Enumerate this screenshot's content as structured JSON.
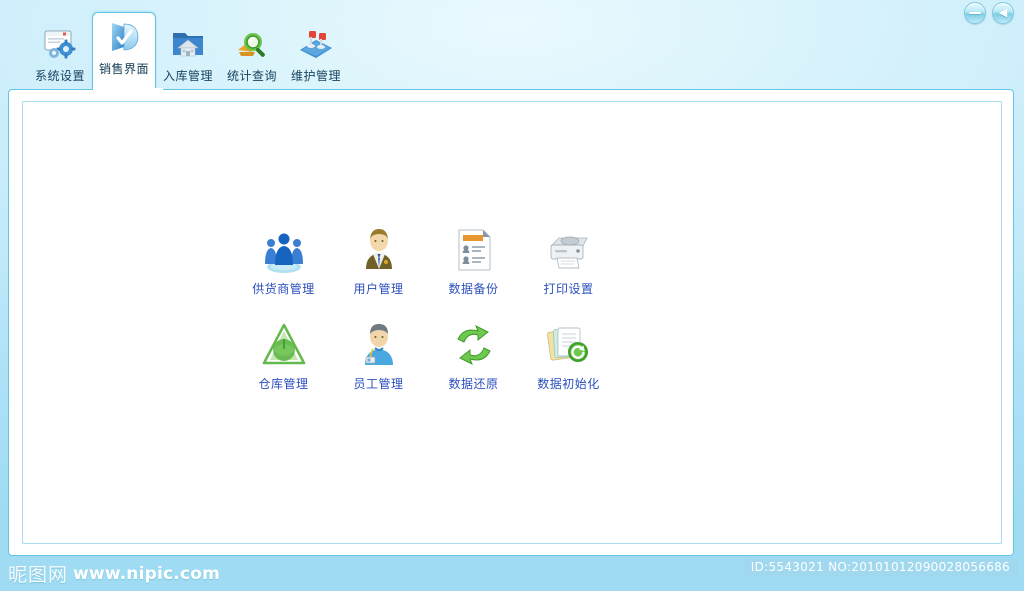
{
  "window": {
    "controls": [
      {
        "name": "minimize-button",
        "icon": "minimize-icon",
        "label": "—"
      },
      {
        "name": "back-button",
        "icon": "back-arrow-icon",
        "label": "◀"
      }
    ]
  },
  "tabs": [
    {
      "label": "系统设置",
      "icon": "settings-window-gear-icon",
      "active": false
    },
    {
      "label": "销售界面",
      "icon": "sales-folder-arrow-icon",
      "active": true
    },
    {
      "label": "入库管理",
      "icon": "warehouse-house-folder-icon",
      "active": false
    },
    {
      "label": "统计查询",
      "icon": "magnifier-chart-icon",
      "active": false
    },
    {
      "label": "维护管理",
      "icon": "pushpin-board-icon",
      "active": false
    }
  ],
  "main": {
    "items": [
      {
        "label": "供货商管理",
        "icon": "people-group-icon"
      },
      {
        "label": "用户管理",
        "icon": "businessman-user-icon"
      },
      {
        "label": "数据备份",
        "icon": "document-contacts-icon"
      },
      {
        "label": "打印设置",
        "icon": "printer-icon"
      },
      {
        "label": "仓库管理",
        "icon": "green-triangle-recycle-icon"
      },
      {
        "label": "员工管理",
        "icon": "employee-badge-icon"
      },
      {
        "label": "数据还原",
        "icon": "green-refresh-arrows-icon"
      },
      {
        "label": "数据初始化",
        "icon": "documents-refresh-icon"
      }
    ]
  },
  "footer": {
    "watermark_cn": "昵图网",
    "watermark_url": "www.nipic.com",
    "id_text": "ID:5543021 NO:20101012090028056686"
  },
  "colors": {
    "accent": "#5fc4e4",
    "label_blue": "#2b4fbe",
    "tab_text": "#18425f",
    "bg_top": "#eaf9fe",
    "bg_bottom": "#9fdcf4"
  }
}
